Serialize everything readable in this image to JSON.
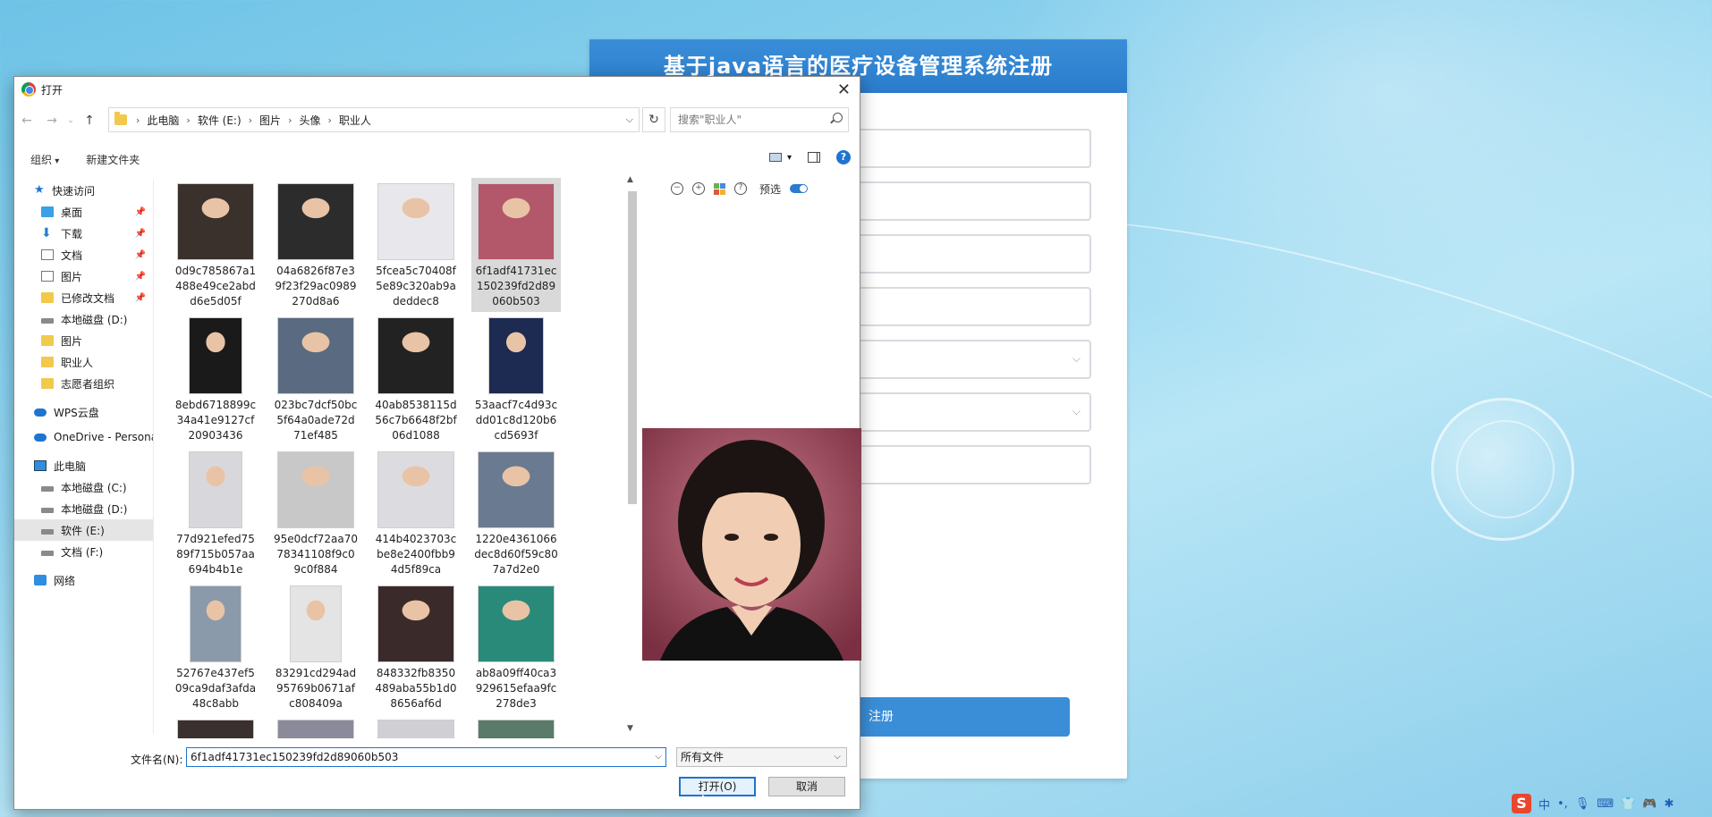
{
  "background_app": {
    "title": "基于java语言的医疗设备管理系统注册",
    "submit_label": "注册"
  },
  "dialog": {
    "title": "打开",
    "breadcrumb": [
      "此电脑",
      "软件 (E:)",
      "图片",
      "头像",
      "职业人"
    ],
    "search_placeholder": "搜索\"职业人\"",
    "toolbar": {
      "organize": "组织",
      "new_folder": "新建文件夹"
    },
    "sidebar": [
      {
        "label": "快速访问",
        "icon": "star-icon",
        "level": 0
      },
      {
        "label": "桌面",
        "icon": "desktop-icon",
        "level": 1,
        "pinned": true
      },
      {
        "label": "下载",
        "icon": "download-icon",
        "level": 1,
        "pinned": true
      },
      {
        "label": "文档",
        "icon": "document-icon",
        "level": 1,
        "pinned": true
      },
      {
        "label": "图片",
        "icon": "pictures-icon",
        "level": 1,
        "pinned": true
      },
      {
        "label": "已修改文档",
        "icon": "folder-icon",
        "level": 1,
        "pinned": true
      },
      {
        "label": "本地磁盘 (D:)",
        "icon": "drive-icon",
        "level": 1
      },
      {
        "label": "图片",
        "icon": "folder-icon",
        "level": 1
      },
      {
        "label": "职业人",
        "icon": "folder-icon",
        "level": 1
      },
      {
        "label": "志愿者组织",
        "icon": "folder-icon",
        "level": 1
      },
      {
        "label": "WPS云盘",
        "icon": "cloud-icon",
        "level": 0
      },
      {
        "label": "OneDrive - Persona",
        "icon": "onedrive-icon",
        "level": 0
      },
      {
        "label": "此电脑",
        "icon": "pc-icon",
        "level": 0
      },
      {
        "label": "本地磁盘 (C:)",
        "icon": "drive-icon",
        "level": 1
      },
      {
        "label": "本地磁盘 (D:)",
        "icon": "drive-icon",
        "level": 1
      },
      {
        "label": "软件 (E:)",
        "icon": "drive-icon",
        "level": 1,
        "selected": true
      },
      {
        "label": "文档 (F:)",
        "icon": "drive-icon",
        "level": 1
      },
      {
        "label": "网络",
        "icon": "network-icon",
        "level": 0
      }
    ],
    "files": [
      {
        "name": "0d9c785867a1488e49ce2abdd6e5d05f",
        "thumb_color": "#3a302c"
      },
      {
        "name": "04a6826f87e39f23f29ac0989270d8a6",
        "thumb_color": "#2c2c2c"
      },
      {
        "name": "5fcea5c70408f5e89c320ab9adeddec8",
        "thumb_color": "#e8e8ec"
      },
      {
        "name": "6f1adf41731ec150239fd2d89060b503",
        "thumb_color": "#b2586a",
        "selected": true
      },
      {
        "name": "8ebd6718899c34a41e9127cf20903436",
        "thumb_color": "#1a1a1a"
      },
      {
        "name": "023bc7dcf50bc5f64a0ade72d71ef485",
        "thumb_color": "#5a6a80"
      },
      {
        "name": "40ab8538115d56c7b6648f2bf06d1088",
        "thumb_color": "#222222"
      },
      {
        "name": "53aacf7c4d93cdd01c8d120b6cd5693f",
        "thumb_color": "#1d2a52"
      },
      {
        "name": "77d921efed7589f715b057aa694b4b1e",
        "thumb_color": "#d8d8dc"
      },
      {
        "name": "95e0dcf72aa7078341108f9c09c0f884",
        "thumb_color": "#c8c8c8"
      },
      {
        "name": "414b4023703cbe8e2400fbb94d5f89ca",
        "thumb_color": "#dcdce0"
      },
      {
        "name": "1220e4361066dec8d60f59c807a7d2e0",
        "thumb_color": "#6a7a90"
      },
      {
        "name": "52767e437ef509ca9daf3afda48c8abb",
        "thumb_color": "#8a9aaa"
      },
      {
        "name": "83291cd294ad95769b0671afc808409a",
        "thumb_color": "#e4e4e4"
      },
      {
        "name": "848332fb8350489aba55b1d08656af6d",
        "thumb_color": "#3a2a2a"
      },
      {
        "name": "ab8a09ff40ca3929615efaa9fc278de3",
        "thumb_color": "#2a8a7a"
      }
    ],
    "preview": {
      "label": "预选"
    },
    "filename_label": "文件名(N):",
    "filename_value": "6f1adf41731ec150239fd2d89060b503",
    "filetype_value": "所有文件",
    "open_button": "打开(O)",
    "cancel_button": "取消"
  },
  "tray": [
    "中",
    "•,",
    "mic",
    "keyboard",
    "shirt",
    "game",
    "gear"
  ]
}
